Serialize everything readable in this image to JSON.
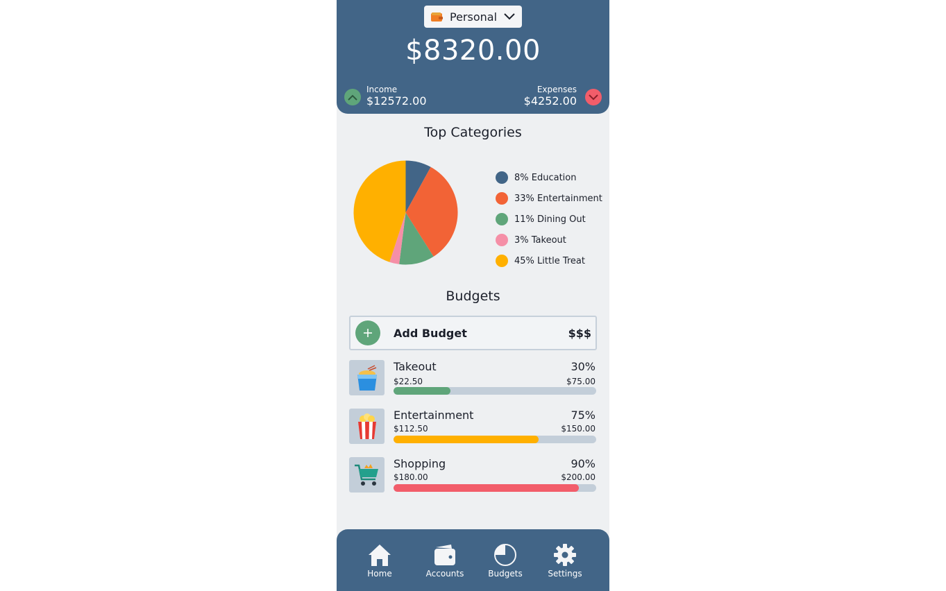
{
  "header": {
    "account_name": "Personal",
    "balance": "$8320.00",
    "income_label": "Income",
    "income_amount": "$12572.00",
    "expenses_label": "Expenses",
    "expenses_amount": "$4252.00",
    "colors": {
      "background": "#426587",
      "income": "#5fa57a",
      "expense": "#f25d6a"
    }
  },
  "top_categories": {
    "title": "Top Categories",
    "legend": [
      {
        "label": "8% Education",
        "color": "#426587"
      },
      {
        "label": "33% Entertainment",
        "color": "#f26336"
      },
      {
        "label": "11% Dining Out",
        "color": "#5fa57a"
      },
      {
        "label": "3% Takeout",
        "color": "#f58fa7"
      },
      {
        "label": "45% Little Treat",
        "color": "#ffb000"
      }
    ]
  },
  "chart_data": {
    "type": "pie",
    "title": "Top Categories",
    "categories": [
      "Education",
      "Entertainment",
      "Dining Out",
      "Takeout",
      "Little Treat"
    ],
    "values": [
      8,
      33,
      11,
      3,
      45
    ],
    "colors": [
      "#426587",
      "#f26336",
      "#5fa57a",
      "#f58fa7",
      "#ffb000"
    ],
    "legend_position": "right"
  },
  "budgets": {
    "title": "Budgets",
    "add_label": "Add Budget",
    "add_amount": "$$$",
    "items": [
      {
        "name": "Takeout",
        "percent": "30%",
        "spent": "$22.50",
        "total": "$75.00",
        "fraction": 0.28,
        "color": "#5fa57a",
        "icon": "noodle-box-icon"
      },
      {
        "name": "Entertainment",
        "percent": "75%",
        "spent": "$112.50",
        "total": "$150.00",
        "fraction": 0.715,
        "color": "#ffb000",
        "icon": "popcorn-icon"
      },
      {
        "name": "Shopping",
        "percent": "90%",
        "spent": "$180.00",
        "total": "$200.00",
        "fraction": 0.915,
        "color": "#f25d6a",
        "icon": "shopping-cart-icon"
      }
    ]
  },
  "nav": {
    "items": [
      {
        "label": "Home",
        "icon": "home-icon"
      },
      {
        "label": "Accounts",
        "icon": "wallet-icon"
      },
      {
        "label": "Budgets",
        "icon": "pie-chart-icon"
      },
      {
        "label": "Settings",
        "icon": "gear-icon"
      }
    ]
  }
}
